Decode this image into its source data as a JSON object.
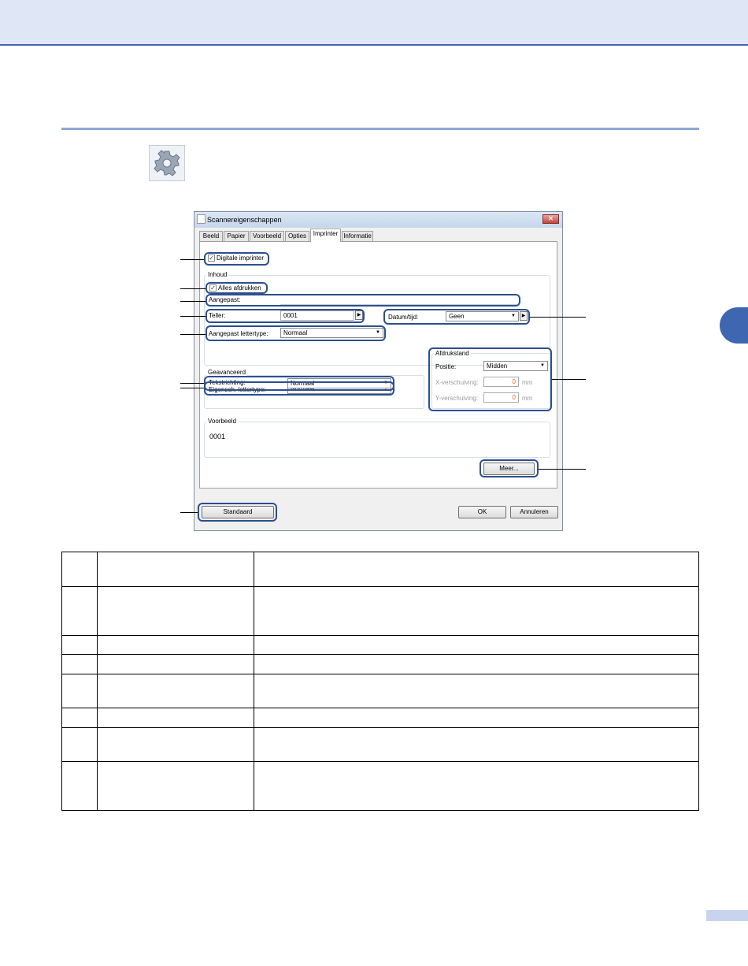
{
  "dialog": {
    "title": "Scannereigenschappen",
    "close_label": "✕",
    "tabs": [
      "Beeld",
      "Papier",
      "Voorbeeld",
      "Opties",
      "Imprinter",
      "Informatie"
    ],
    "active_tab": "Imprinter",
    "digital_imprinter": {
      "label": "Digitale imprinter",
      "checked": true
    },
    "inhoud": {
      "legend": "Inhoud",
      "alle_afdrukken": {
        "label": "Alles afdrukken",
        "checked": true
      },
      "aangepast_label": "Aangepast:",
      "teller_label": "Teller:",
      "teller_value": "0001",
      "datum_label": "Datum/tijd:",
      "datum_value": "Geen",
      "lettertype_label": "Aangepast lettertype:",
      "lettertype_value": "Normaal"
    },
    "geavanceerd": {
      "legend": "Geavanceerd",
      "eigensch_label": "Eigensch. lettertype:",
      "eigensch_value": "Normaal",
      "tekstrichting_label": "Tekstrichting:",
      "tekstrichting_value": "Normaal"
    },
    "afdrukstand": {
      "legend": "Afdrukstand",
      "positie_label": "Positie:",
      "positie_value": "Midden",
      "x_label": "X-verschuiving:",
      "x_value": "0",
      "y_label": "Y-verschuiving:",
      "y_value": "0",
      "unit": "mm"
    },
    "voorbeeld": {
      "legend": "Voorbeeld",
      "text": "0001"
    },
    "meer_button": "Meer...",
    "standaard_button": "Standaard",
    "ok_button": "OK",
    "annuleren_button": "Annuleren"
  },
  "colors": {
    "accent": "#3f66b0",
    "callout": "#2c4f8e",
    "header_bg": "#dfe6f5"
  },
  "icons": {
    "header": "gear-icon"
  }
}
